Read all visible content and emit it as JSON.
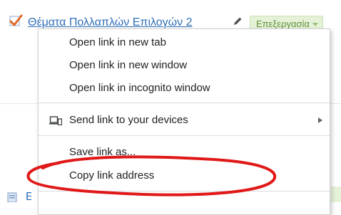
{
  "page": {
    "link_text": "Θέματα Πολλαπλών Επιλογών 2",
    "status_badge": "Επεξεργασία",
    "bottom_link_fragment": "Ε"
  },
  "context_menu": {
    "items": [
      {
        "label": "Open link in new tab"
      },
      {
        "label": "Open link in new window"
      },
      {
        "label": "Open link in incognito window"
      },
      {
        "label": "Send link to your devices",
        "icon": "devices-icon",
        "has_submenu": true
      },
      {
        "label": "Save link as..."
      },
      {
        "label": "Copy link address",
        "highlighted_by_annotation": true
      }
    ]
  },
  "colors": {
    "link": "#2f6fb6",
    "check": "#e06a28",
    "badge_bg": "#e6f2d8",
    "badge_text": "#5f8f3a",
    "annotation": "#e01818"
  }
}
